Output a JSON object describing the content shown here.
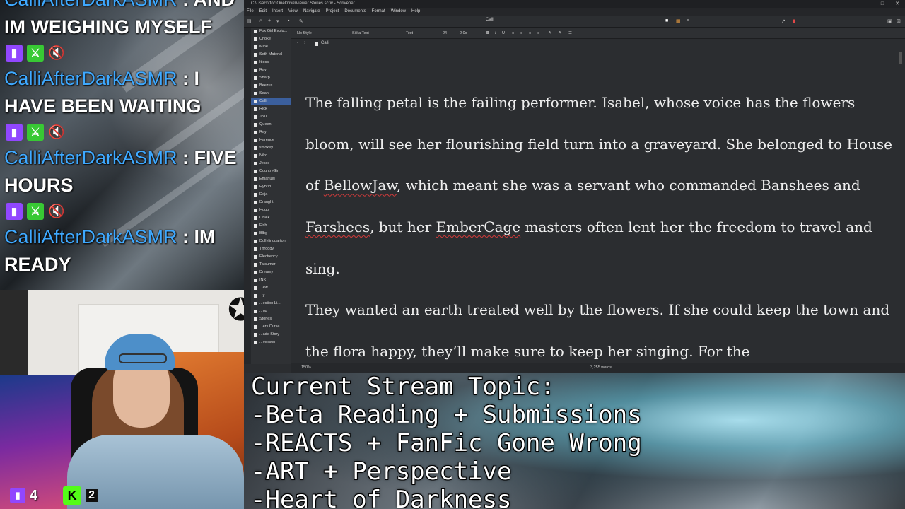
{
  "chat": {
    "top_line": "CalliAfterDarkASMR : AND",
    "messages": [
      {
        "lines_before": [
          "IM WEIGHING MYSELF"
        ]
      },
      {
        "user": "CalliAfterDarkASMR",
        "sep": " : ",
        "first": "I",
        "rest": "HAVE BEEN WAITING"
      },
      {
        "user": "CalliAfterDarkASMR",
        "sep": " : ",
        "first": "FIVE",
        "rest": "HOURS"
      },
      {
        "user": "CalliAfterDarkASMR",
        "sep": " : ",
        "first": "IM",
        "rest": "READY"
      }
    ],
    "badge_icons": [
      "twitch-icon",
      "sword-icon",
      "mute-icon"
    ]
  },
  "window": {
    "title": "C:\\Users\\ttoc\\OneDrive\\Viewer Stories.scriv - Scrivener",
    "controls": [
      "–",
      "□",
      "✕"
    ],
    "menu": [
      "File",
      "Edit",
      "Insert",
      "View",
      "Navigate",
      "Project",
      "Documents",
      "Format",
      "Window",
      "Help"
    ],
    "doc_title": "Calli"
  },
  "binder": {
    "items": [
      "Fox Girl Evolu...",
      "Choke",
      "Mine",
      "Seth Material",
      "Ittocs",
      "Ray",
      "Sharp",
      "Beezus",
      "Sean",
      "Calli",
      "Rick",
      "Jolu",
      "Queen",
      "Ray",
      "Haregue",
      "smokey",
      "Niko",
      "Jesse",
      "CountryGirl",
      "Emanuel",
      "Hybrid",
      "Deja",
      "Draught",
      "Hugo",
      "Obiek",
      "Fish",
      "Blbg",
      "Dollyfingparton",
      "Throggy",
      "Electrency",
      "Tatsumari",
      "Dreamy",
      "INK",
      "...ew",
      "...y",
      "...ection Li...",
      "...ng",
      "Stories",
      "...ers Curse",
      "...ade Story",
      "...venson"
    ],
    "selected_index": 9
  },
  "format": {
    "style": "No Style",
    "font": "Sitka Text",
    "face": "Text",
    "size": "24",
    "spacing": "2.0x"
  },
  "editor": {
    "paragraphs": [
      [
        "The falling petal is the failing performer. Isabel, whose voice has the flowers bloom, will see her flourishing field turn into a graveyard. She belonged to House of ",
        {
          "spell": "BellowJaw"
        },
        ", which meant she was a servant who commanded Banshees and ",
        {
          "spell": "Farshees"
        },
        ", but her ",
        {
          "spell": "EmberCage"
        },
        " masters often lent her the freedom to travel and sing."
      ],
      [
        "They wanted an earth treated well by the flowers. If she could keep the town and the flora happy, they’ll make sure to keep her singing. For the"
      ]
    ]
  },
  "status": {
    "zoom": "150%",
    "word_count": "3,255 words"
  },
  "stream_topic": {
    "lines": [
      "Current Stream Topic:",
      "-Beta Reading + Submissions",
      "-REACTS + FanFic Gone Wrong",
      "-ART + Perspective",
      "-Heart of Darkness"
    ]
  },
  "viewers": {
    "twitch_count": "4",
    "kick_count": "2"
  },
  "colors": {
    "chat_username": "#3fa9ff",
    "twitch": "#9147ff",
    "kick": "#53fc18",
    "binder_selected": "#3b5f9d",
    "spellcheck": "#d23b3b"
  }
}
